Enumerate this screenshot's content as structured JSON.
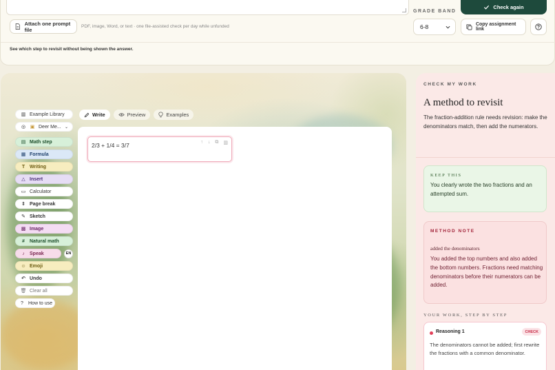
{
  "top": {
    "grade_band_label": "GRADE BAND",
    "check_again_label": "Check again",
    "attach_label": "Attach one prompt file",
    "attach_hint": "PDF, image, Word, or text · one file-assisted check per day while unfunded",
    "grade_value": "6-8",
    "copy_link_label": "Copy assignment link",
    "visit_note": "See which step to revisit without being shown the answer."
  },
  "tabs": [
    {
      "label": "Write",
      "active": true
    },
    {
      "label": "Preview",
      "active": false
    },
    {
      "label": "Examples",
      "active": false
    }
  ],
  "sidebar": {
    "example_library": "Example Library",
    "theme": "Deer Me...",
    "items": [
      {
        "label": "Math step"
      },
      {
        "label": "Formula"
      },
      {
        "label": "Writing"
      },
      {
        "label": "Insert"
      },
      {
        "label": "Calculator"
      },
      {
        "label": "Page break"
      },
      {
        "label": "Sketch"
      },
      {
        "label": "Image"
      },
      {
        "label": "Natural math"
      },
      {
        "label": "Speak"
      },
      {
        "label": "Emoji"
      },
      {
        "label": "Undo"
      },
      {
        "label": "Clear all"
      },
      {
        "label": "How to use"
      }
    ],
    "lang": "EN"
  },
  "editor": {
    "expression": "2/3 + 1/4 = 3/7"
  },
  "check": {
    "kicker": "CHECK MY WORK",
    "title": "A method to revisit",
    "description": "The fraction-addition rule needs revision: make the denominators match, then add the numerators.",
    "keep_label": "KEEP THIS",
    "keep_text": "You clearly wrote the two fractions and an attempted sum.",
    "method_label": "METHOD NOTE",
    "method_sub": "added the denominators",
    "method_text": "You added the top numbers and also added the bottom numbers. Fractions need matching denominators before their numerators can be added.",
    "steps_label": "YOUR WORK, STEP BY STEP",
    "step_title": "Reasoning 1",
    "step_badge": "CHECK",
    "step_text": "The denominators cannot be added; first rewrite the fractions with a common denominator."
  }
}
